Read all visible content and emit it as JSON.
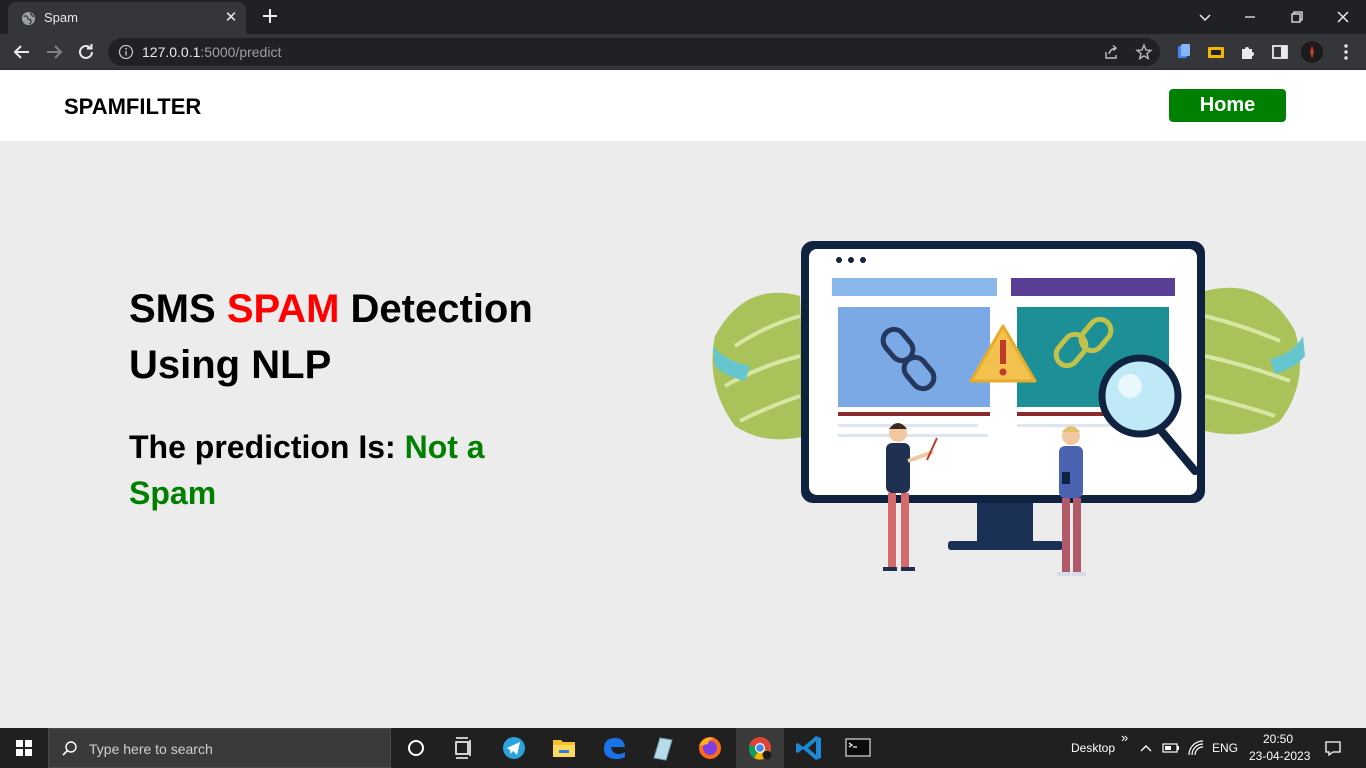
{
  "browser": {
    "tab_title": "Spam",
    "url_host": "127.0.0.1",
    "url_rest": ":5000/predict"
  },
  "navbar": {
    "brand": "SPAMFILTER",
    "home_label": "Home"
  },
  "hero": {
    "title_sms": "SMS",
    "title_spam": "SPAM",
    "title_detection": "Detection",
    "title_using": "Using",
    "title_nlp": "NLP",
    "prediction_label": "The prediction Is:",
    "prediction_value": "Not a Spam"
  },
  "taskbar": {
    "search_placeholder": "Type here to search",
    "desktop_label": "Desktop",
    "chevron": "»",
    "language": "ENG",
    "time": "20:50",
    "date": "23-04-2023"
  },
  "colors": {
    "accent_green": "#008000",
    "spam_red": "#ff0000",
    "chrome_dark": "#202124"
  }
}
